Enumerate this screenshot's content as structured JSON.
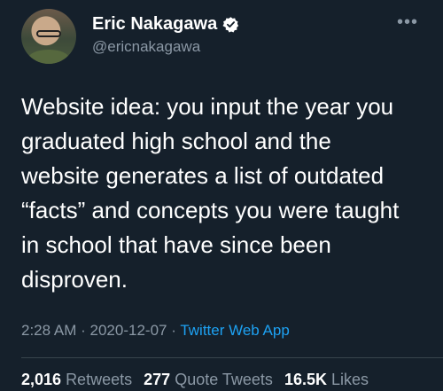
{
  "author": {
    "display_name": "Eric Nakagawa",
    "handle": "@ericnakagawa"
  },
  "icons": {
    "verified": "verified-badge-icon",
    "more": "more-options-icon",
    "more_glyph": "•••"
  },
  "tweet": {
    "text": "Website idea: you input the year you\ngraduated high school and the\nwebsite generates a list of outdated\n“facts” and concepts you were taught\nin school that have since been\ndisproven.",
    "time": "2:28 AM",
    "date": "2020-12-07",
    "separator": "·",
    "source": "Twitter Web App"
  },
  "stats": {
    "retweets": {
      "count": "2,016",
      "label": "Retweets"
    },
    "quote_tweets": {
      "count": "277",
      "label": "Quote Tweets"
    },
    "likes": {
      "count": "16.5K",
      "label": "Likes"
    }
  },
  "colors": {
    "background": "#15202b",
    "text": "#ffffff",
    "secondary": "#8b98a5",
    "accent": "#1da1f2"
  }
}
